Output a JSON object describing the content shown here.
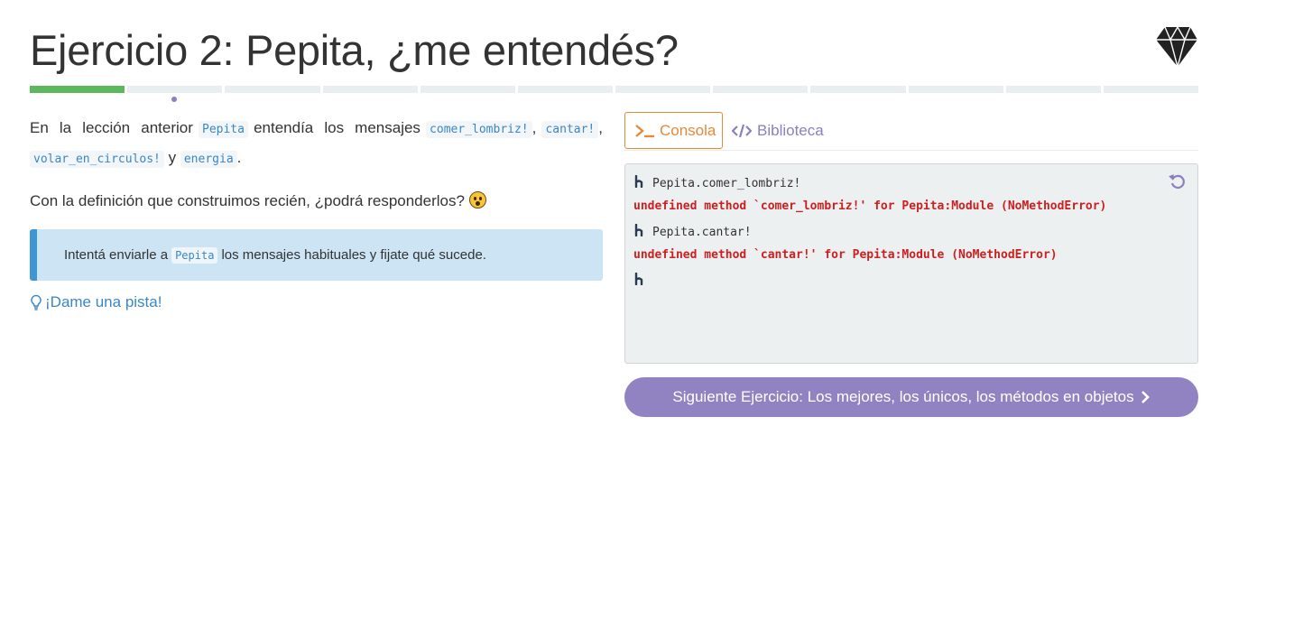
{
  "header": {
    "title": "Ejercicio 2: Pepita, ¿me entendés?"
  },
  "progress": {
    "total_segments": 12,
    "completed_segments": 1,
    "current_index": 2
  },
  "description": {
    "p1_lead": "En la lección anterior",
    "p1_obj": "Pepita",
    "p1_mid": "entendía los mensajes",
    "msg1": "comer_lombriz!",
    "sep1": ",",
    "msg2": "cantar!",
    "sep2": ",",
    "msg3": "volar_en_circulos!",
    "conj": "y",
    "msg4": "energia",
    "end": ".",
    "p2": "Con la definición que construimos recién, ¿podrá responderlos?"
  },
  "callout": {
    "pre": "Intentá enviarle a",
    "code": "Pepita",
    "post": "los mensajes habituales y fijate qué sucede."
  },
  "hint": {
    "label": "¡Dame una pista!"
  },
  "tabs": {
    "console_label": "Consola",
    "library_label": "Biblioteca"
  },
  "console": {
    "lines": [
      {
        "type": "cmd",
        "text": "Pepita.comer_lombriz!"
      },
      {
        "type": "err",
        "text": "undefined method `comer_lombriz!' for Pepita:Module (NoMethodError)"
      },
      {
        "type": "cmd",
        "text": "Pepita.cantar!"
      },
      {
        "type": "err",
        "text": "undefined method `cantar!' for Pepita:Module (NoMethodError)"
      }
    ]
  },
  "next": {
    "label": "Siguiente Ejercicio: Los mejores, los únicos, los métodos en objetos"
  },
  "colors": {
    "accent_purple": "#9183c2",
    "console_orange": "#e8883a",
    "error_red": "#cc1f1f",
    "progress_green": "#5cb85c",
    "link_blue": "#3a87c6"
  }
}
